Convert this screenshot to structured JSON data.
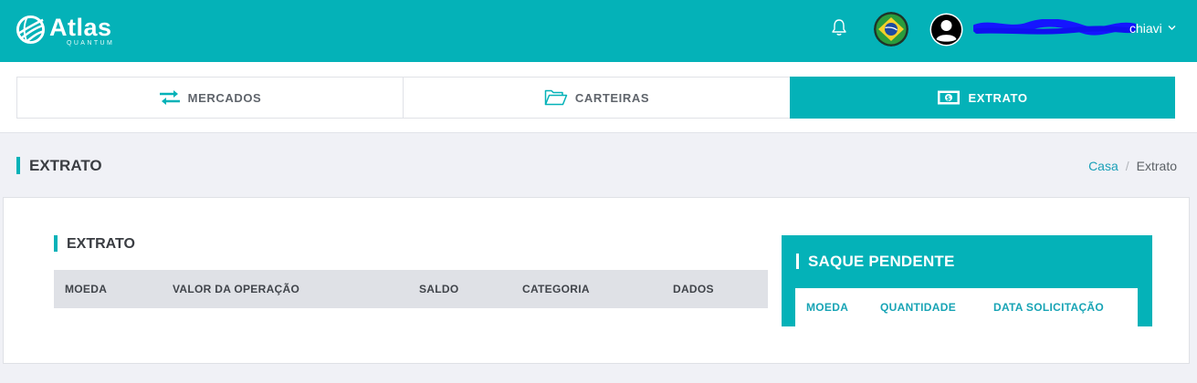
{
  "brand": {
    "name": "Atlas",
    "tagline": "QUANTUM",
    "color": "#04b2b8"
  },
  "header": {
    "icons": [
      "bell-icon",
      "brazil-flag-icon",
      "user-avatar-icon",
      "chevron-down-icon"
    ],
    "username_visible": "chiavi"
  },
  "tabs": [
    {
      "label": "MERCADOS",
      "icon": "exchange-arrows-icon",
      "active": false
    },
    {
      "label": "CARTEIRAS",
      "icon": "folder-open-icon",
      "active": false
    },
    {
      "label": "EXTRATO",
      "icon": "banknote-icon",
      "active": true
    }
  ],
  "page": {
    "title": "EXTRATO",
    "breadcrumb": [
      "Casa",
      "Extrato"
    ]
  },
  "statement": {
    "title": "EXTRATO",
    "columns": [
      "MOEDA",
      "VALOR DA OPERAÇÃO",
      "SALDO",
      "CATEGORIA",
      "DADOS"
    ],
    "rows": []
  },
  "pending_withdrawal": {
    "title": "SAQUE PENDENTE",
    "columns": [
      "MOEDA",
      "QUANTIDADE",
      "DATA SOLICITAÇÃO"
    ],
    "rows": []
  }
}
